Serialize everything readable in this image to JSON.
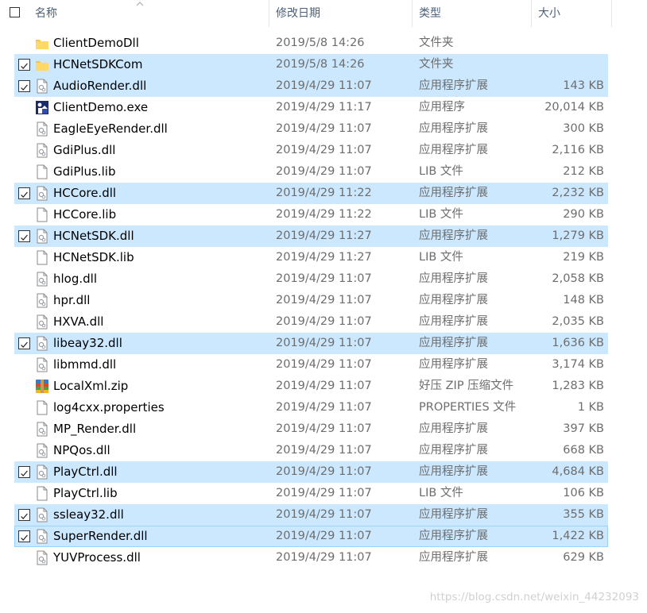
{
  "header": {
    "name_col": "名称",
    "date_col": "修改日期",
    "type_col": "类型",
    "size_col": "大小"
  },
  "files": [
    {
      "name": "ClientDemoDll",
      "date": "2019/5/8 14:26",
      "type": "文件夹",
      "size": "",
      "icon": "folder-icon",
      "checked": false,
      "selected": false
    },
    {
      "name": "HCNetSDKCom",
      "date": "2019/5/8 14:26",
      "type": "文件夹",
      "size": "",
      "icon": "folder-icon",
      "checked": true,
      "selected": true
    },
    {
      "name": "AudioRender.dll",
      "date": "2019/4/29 11:07",
      "type": "应用程序扩展",
      "size": "143 KB",
      "icon": "dll-file-icon",
      "checked": true,
      "selected": true
    },
    {
      "name": "ClientDemo.exe",
      "date": "2019/4/29 11:17",
      "type": "应用程序",
      "size": "20,014 KB",
      "icon": "exe-app-icon",
      "checked": false,
      "selected": false
    },
    {
      "name": "EagleEyeRender.dll",
      "date": "2019/4/29 11:07",
      "type": "应用程序扩展",
      "size": "300 KB",
      "icon": "dll-file-icon",
      "checked": false,
      "selected": false
    },
    {
      "name": "GdiPlus.dll",
      "date": "2019/4/29 11:07",
      "type": "应用程序扩展",
      "size": "2,116 KB",
      "icon": "dll-file-icon",
      "checked": false,
      "selected": false
    },
    {
      "name": "GdiPlus.lib",
      "date": "2019/4/29 11:07",
      "type": "LIB 文件",
      "size": "212 KB",
      "icon": "file-icon",
      "checked": false,
      "selected": false
    },
    {
      "name": "HCCore.dll",
      "date": "2019/4/29 11:22",
      "type": "应用程序扩展",
      "size": "2,232 KB",
      "icon": "dll-file-icon",
      "checked": true,
      "selected": true
    },
    {
      "name": "HCCore.lib",
      "date": "2019/4/29 11:22",
      "type": "LIB 文件",
      "size": "290 KB",
      "icon": "file-icon",
      "checked": false,
      "selected": false
    },
    {
      "name": "HCNetSDK.dll",
      "date": "2019/4/29 11:27",
      "type": "应用程序扩展",
      "size": "1,279 KB",
      "icon": "dll-file-icon",
      "checked": true,
      "selected": true
    },
    {
      "name": "HCNetSDK.lib",
      "date": "2019/4/29 11:27",
      "type": "LIB 文件",
      "size": "219 KB",
      "icon": "file-icon",
      "checked": false,
      "selected": false
    },
    {
      "name": "hlog.dll",
      "date": "2019/4/29 11:07",
      "type": "应用程序扩展",
      "size": "2,058 KB",
      "icon": "dll-file-icon",
      "checked": false,
      "selected": false
    },
    {
      "name": "hpr.dll",
      "date": "2019/4/29 11:07",
      "type": "应用程序扩展",
      "size": "148 KB",
      "icon": "dll-file-icon",
      "checked": false,
      "selected": false
    },
    {
      "name": "HXVA.dll",
      "date": "2019/4/29 11:07",
      "type": "应用程序扩展",
      "size": "2,035 KB",
      "icon": "dll-file-icon",
      "checked": false,
      "selected": false
    },
    {
      "name": "libeay32.dll",
      "date": "2019/4/29 11:07",
      "type": "应用程序扩展",
      "size": "1,636 KB",
      "icon": "dll-file-icon",
      "checked": true,
      "selected": true
    },
    {
      "name": "libmmd.dll",
      "date": "2019/4/29 11:07",
      "type": "应用程序扩展",
      "size": "3,174 KB",
      "icon": "dll-file-icon",
      "checked": false,
      "selected": false
    },
    {
      "name": "LocalXml.zip",
      "date": "2019/4/29 11:07",
      "type": "好压 ZIP 压缩文件",
      "size": "1,283 KB",
      "icon": "zip-archive-icon",
      "checked": false,
      "selected": false
    },
    {
      "name": "log4cxx.properties",
      "date": "2019/4/29 11:07",
      "type": "PROPERTIES 文件",
      "size": "1 KB",
      "icon": "file-icon",
      "checked": false,
      "selected": false
    },
    {
      "name": "MP_Render.dll",
      "date": "2019/4/29 11:07",
      "type": "应用程序扩展",
      "size": "397 KB",
      "icon": "dll-file-icon",
      "checked": false,
      "selected": false
    },
    {
      "name": "NPQos.dll",
      "date": "2019/4/29 11:07",
      "type": "应用程序扩展",
      "size": "668 KB",
      "icon": "dll-file-icon",
      "checked": false,
      "selected": false
    },
    {
      "name": "PlayCtrl.dll",
      "date": "2019/4/29 11:07",
      "type": "应用程序扩展",
      "size": "4,684 KB",
      "icon": "dll-file-icon",
      "checked": true,
      "selected": true
    },
    {
      "name": "PlayCtrl.lib",
      "date": "2019/4/29 11:07",
      "type": "LIB 文件",
      "size": "106 KB",
      "icon": "file-icon",
      "checked": false,
      "selected": false
    },
    {
      "name": "ssleay32.dll",
      "date": "2019/4/29 11:07",
      "type": "应用程序扩展",
      "size": "355 KB",
      "icon": "dll-file-icon",
      "checked": true,
      "selected": true
    },
    {
      "name": "SuperRender.dll",
      "date": "2019/4/29 11:07",
      "type": "应用程序扩展",
      "size": "1,422 KB",
      "icon": "dll-file-icon",
      "checked": true,
      "selected": true,
      "focused": true
    },
    {
      "name": "YUVProcess.dll",
      "date": "2019/4/29 11:07",
      "type": "应用程序扩展",
      "size": "629 KB",
      "icon": "dll-file-icon",
      "checked": false,
      "selected": false
    }
  ],
  "watermark": "https://blog.csdn.net/weixin_44232093",
  "colors": {
    "selection": "#cce8ff",
    "focus_border": "#99d1ff",
    "header_text": "#4c607a",
    "secondary_text": "#6d6d6d"
  }
}
